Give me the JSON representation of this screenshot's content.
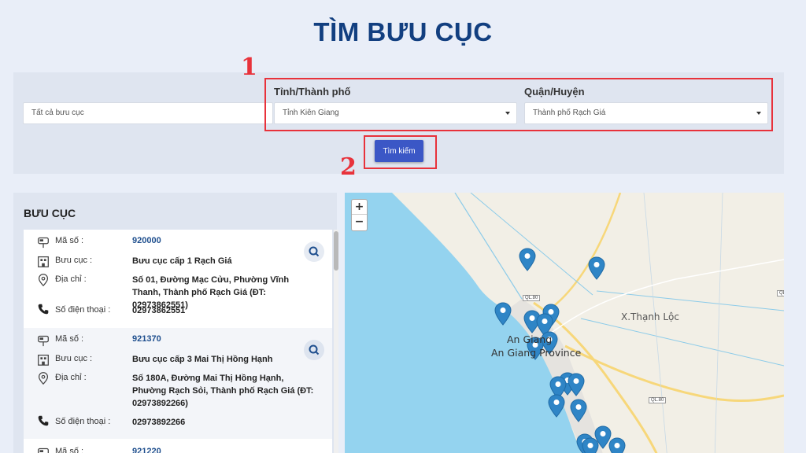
{
  "page": {
    "title": "TÌM BƯU CỤC"
  },
  "search": {
    "postoffice_placeholder": "Tất cả bưu cục",
    "province_label": "Tỉnh/Thành phố",
    "province_value": "Tỉnh Kiên Giang",
    "district_label": "Quận/Huyện",
    "district_value": "Thành phố Rạch Giá",
    "button_label": "Tìm kiếm"
  },
  "annotations": {
    "box1_number": "1",
    "box2_number": "2"
  },
  "list": {
    "title": "BƯU CỤC",
    "field_labels": {
      "code": "Mã số :",
      "name": "Bưu cục :",
      "address": "Địa chỉ :",
      "phone": "Số điện thoại :"
    },
    "items": [
      {
        "code": "920000",
        "name": "Bưu cục cấp 1 Rạch Giá",
        "address": "Số 01, Đường Mạc Cửu, Phường Vĩnh Thanh, Thành phố Rạch Giá (ĐT: 02973862551)",
        "phone": "02973862551"
      },
      {
        "code": "921370",
        "name": "Bưu cục cấp 3 Mai Thị Hồng Hạnh",
        "address": "Số 180A, Đường Mai Thị Hồng Hạnh, Phường Rạch Sỏi, Thành phố Rạch Giá (ĐT: 02973892266)",
        "phone": "02973892266"
      },
      {
        "code": "921220"
      }
    ]
  },
  "map": {
    "zoom_in": "+",
    "zoom_out": "−",
    "labels": {
      "place_1": "X.Thạnh Lộc",
      "city_1": "An Giang",
      "city_2": "An Giang Province"
    },
    "road_badges": {
      "ql80_a": "QL.80",
      "ql80_b": "QL.80",
      "ql80_c": "QL.80"
    },
    "colors": {
      "sea": "#94d3ef",
      "land": "#f2efe6",
      "road": "#f7d77a",
      "marker": "#2f85c6"
    }
  }
}
